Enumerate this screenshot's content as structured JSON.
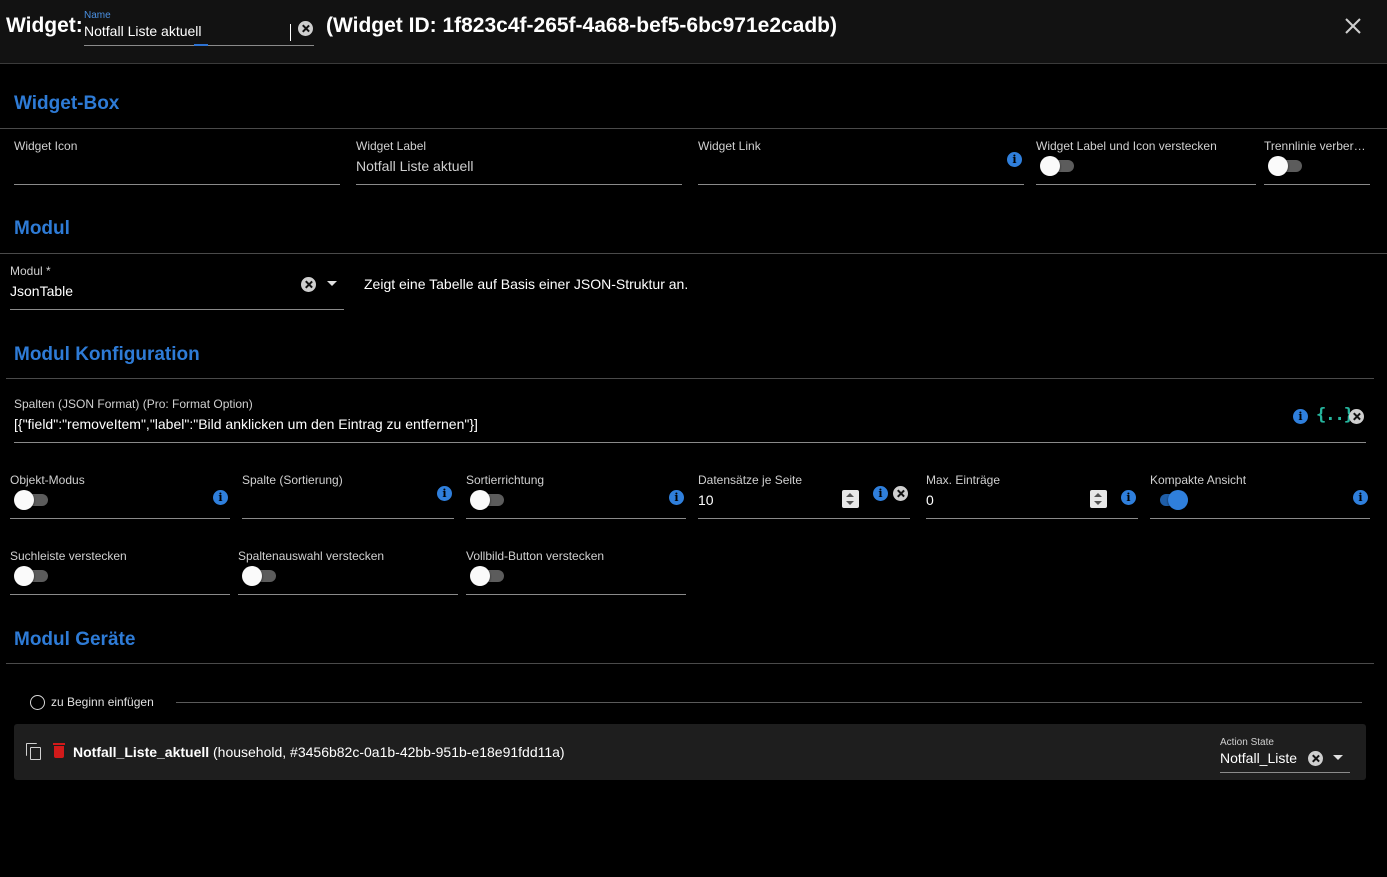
{
  "header": {
    "label": "Widget:",
    "name_caption": "Name",
    "name_value": "Notfall Liste aktuell",
    "widget_id": "(Widget ID: 1f823c4f-265f-4a68-bef5-6bc971e2cadb)"
  },
  "widget_box": {
    "title": "Widget-Box",
    "fields": [
      {
        "label": "Widget Icon",
        "value": ""
      },
      {
        "label": "Widget Label",
        "value": "Notfall Liste aktuell"
      },
      {
        "label": "Widget Link",
        "value": ""
      },
      {
        "label": "Widget Label und Icon verstecken",
        "toggle": false
      },
      {
        "label": "Trennlinie verberg…",
        "toggle": false
      }
    ]
  },
  "modul": {
    "title": "Modul",
    "field_label": "Modul *",
    "field_value": "JsonTable",
    "description": "Zeigt eine Tabelle auf Basis einer JSON-Struktur an."
  },
  "modul_konfiguration": {
    "title": "Modul Konfiguration",
    "columns_label": "Spalten (JSON Format) (Pro: Format Option)",
    "columns_value": "[{\"field\":\"removeItem\",\"label\":\"Bild anklicken um den Eintrag zu entfernen\"}]",
    "json_icon_text": "{..}",
    "row1": [
      {
        "label": "Objekt-Modus",
        "toggle": false
      },
      {
        "label": "Spalte (Sortierung)",
        "value": ""
      },
      {
        "label": "Sortierrichtung",
        "toggle": false
      },
      {
        "label": "Datensätze je Seite",
        "value": "10"
      },
      {
        "label": "Max. Einträge",
        "value": "0"
      },
      {
        "label": "Kompakte Ansicht",
        "toggle": true
      }
    ],
    "row2": [
      {
        "label": "Suchleiste verstecken",
        "toggle": false
      },
      {
        "label": "Spaltenauswahl verstecken",
        "toggle": false
      },
      {
        "label": "Vollbild-Button verstecken",
        "toggle": false
      }
    ]
  },
  "modul_geraete": {
    "title": "Modul Geräte",
    "insert_label": "zu Beginn einfügen",
    "device": {
      "name": "Notfall_Liste_aktuell",
      "meta": "(household, #3456b82c-0a1b-42bb-951b-e18e91fdd11a)",
      "action_label": "Action State",
      "action_value": "Notfall_Liste"
    }
  },
  "colors": {
    "accent": "#2e7bd6",
    "background": "#000000",
    "header_background": "#121212",
    "json_icon": "#26b59e",
    "delete": "#d11a1a"
  }
}
